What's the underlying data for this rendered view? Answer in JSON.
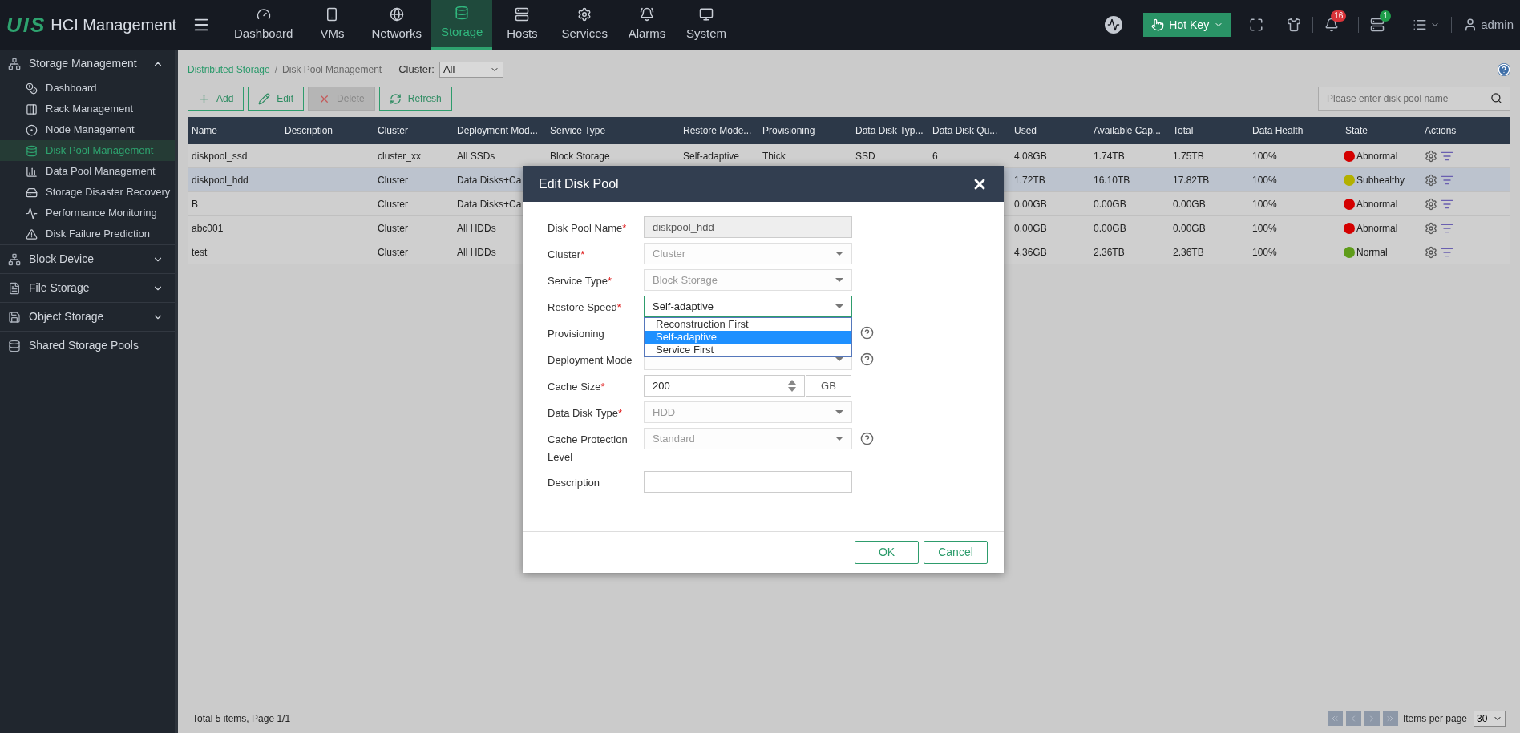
{
  "topbar": {
    "logo": "UIS",
    "title": "HCI Management",
    "tabs": [
      {
        "label": "Dashboard",
        "selected": false
      },
      {
        "label": "VMs",
        "selected": false
      },
      {
        "label": "Networks",
        "selected": false
      },
      {
        "label": "Storage",
        "selected": true
      },
      {
        "label": "Hosts",
        "selected": false
      },
      {
        "label": "Services",
        "selected": false
      },
      {
        "label": "Alarms",
        "selected": false
      },
      {
        "label": "System",
        "selected": false
      }
    ],
    "hotkey": "Hot Key",
    "alarm_count": "16",
    "task_count": "1",
    "user": "admin"
  },
  "sidebar": [
    {
      "kind": "group",
      "label": "Storage Management",
      "expanded": true,
      "children": [
        {
          "label": "Dashboard",
          "selected": false
        },
        {
          "label": "Rack Management",
          "selected": false
        },
        {
          "label": "Node Management",
          "selected": false
        },
        {
          "label": "Disk Pool Management",
          "selected": true
        },
        {
          "label": "Data Pool Management",
          "selected": false
        },
        {
          "label": "Storage Disaster Recovery",
          "selected": false
        },
        {
          "label": "Performance Monitoring",
          "selected": false
        },
        {
          "label": "Disk Failure Prediction",
          "selected": false
        }
      ]
    },
    {
      "kind": "group",
      "label": "Block Device",
      "expanded": false
    },
    {
      "kind": "group",
      "label": "File Storage",
      "expanded": false
    },
    {
      "kind": "group",
      "label": "Object Storage",
      "expanded": false
    },
    {
      "kind": "link",
      "label": "Shared Storage Pools"
    }
  ],
  "breadcrumb": {
    "parent": "Distributed Storage",
    "separator": "/",
    "current": "Disk Pool Management",
    "cluster_label": "Cluster:",
    "cluster_value": "All"
  },
  "toolbar": [
    {
      "label": "Add",
      "disabled": false
    },
    {
      "label": "Edit",
      "disabled": false
    },
    {
      "label": "Delete",
      "disabled": true
    },
    {
      "label": "Refresh",
      "disabled": false
    }
  ],
  "search": {
    "placeholder": "Please enter disk pool name"
  },
  "table": {
    "columns": [
      "Name",
      "Description",
      "Cluster",
      "Deployment Mod...",
      "Service Type",
      "Restore Mode...",
      "Provisioning",
      "Data Disk Typ...",
      "Data Disk Qu...",
      "Used",
      "Available Cap...",
      "Total",
      "Data Health",
      "State",
      "Actions"
    ],
    "rows": [
      {
        "selected": false,
        "cells": [
          "diskpool_ssd",
          null,
          "cluster_xx",
          "All SSDs",
          "Block Storage",
          "Self-adaptive",
          "Thick",
          "SSD",
          "6",
          "4.08GB",
          "1.74TB",
          "1.75TB",
          "100%"
        ],
        "state": {
          "label": "Abnormal",
          "color": "#d40000"
        }
      },
      {
        "selected": true,
        "cells": [
          "diskpool_hdd",
          null,
          "Cluster",
          "Data Disks+Ca",
          null,
          null,
          null,
          null,
          null,
          "1.72TB",
          "16.10TB",
          "17.82TB",
          "100%"
        ],
        "state": {
          "label": "Subhealthy",
          "color": "#b3b000"
        }
      },
      {
        "selected": false,
        "cells": [
          "B",
          null,
          "Cluster",
          "Data Disks+Ca",
          null,
          null,
          null,
          null,
          null,
          "0.00GB",
          "0.00GB",
          "0.00GB",
          "100%"
        ],
        "state": {
          "label": "Abnormal",
          "color": "#d40000"
        }
      },
      {
        "selected": false,
        "cells": [
          "abc001",
          null,
          "Cluster",
          "All HDDs",
          null,
          null,
          null,
          null,
          null,
          "0.00GB",
          "0.00GB",
          "0.00GB",
          "100%"
        ],
        "state": {
          "label": "Abnormal",
          "color": "#d40000"
        }
      },
      {
        "selected": false,
        "cells": [
          "test",
          null,
          "Cluster",
          "All HDDs",
          null,
          null,
          null,
          null,
          null,
          "4.36GB",
          "2.36TB",
          "2.36TB",
          "100%"
        ],
        "state": {
          "label": "Normal",
          "color": "#5f9c1a"
        }
      }
    ]
  },
  "footer": {
    "summary": "Total 5 items, Page 1/1",
    "per_page_label": "Items per page",
    "per_page": "30"
  },
  "dialog": {
    "title": "Edit Disk Pool",
    "required_mark": "*",
    "fields": [
      {
        "kind": "text",
        "label": "Disk Pool Name",
        "required": true,
        "disabled": true,
        "value": "diskpool_hdd"
      },
      {
        "kind": "select",
        "label": "Cluster",
        "required": true,
        "disabled": true,
        "value": "Cluster"
      },
      {
        "kind": "select",
        "label": "Service Type",
        "required": true,
        "disabled": true,
        "value": "Block Storage"
      },
      {
        "kind": "select",
        "label": "Restore Speed",
        "required": true,
        "disabled": false,
        "value": "Self-adaptive",
        "expanded": true,
        "options": [
          {
            "label": "Reconstruction First",
            "selected": false
          },
          {
            "label": "Self-adaptive",
            "selected": true
          },
          {
            "label": "Service First",
            "selected": false
          }
        ]
      },
      {
        "kind": "covered",
        "label": "Provisioning",
        "required": false,
        "help": true
      },
      {
        "kind": "select",
        "label": "Deployment Mode",
        "required": false,
        "disabled": true,
        "help": true
      },
      {
        "kind": "number",
        "label": "Cache Size",
        "required": true,
        "disabled": false,
        "value": "200",
        "unit": "GB"
      },
      {
        "kind": "select",
        "label": "Data Disk Type",
        "required": true,
        "disabled": true,
        "value": "HDD"
      },
      {
        "kind": "select",
        "label": "Cache Protection Level",
        "required": false,
        "disabled": true,
        "value": "Standard",
        "help": true
      },
      {
        "kind": "text",
        "label": "Description",
        "required": false,
        "disabled": false
      }
    ],
    "buttons": [
      "OK",
      "Cancel"
    ]
  }
}
